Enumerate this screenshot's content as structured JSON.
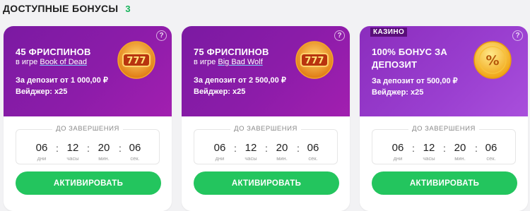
{
  "header": {
    "title": "ДОСТУПНЫЕ БОНУСЫ",
    "count": "3"
  },
  "colors": {
    "accent_green": "#23c55e",
    "card_purple": "#8c1ca9",
    "card_purple_light": "#9a3fd0",
    "count_green": "#17b45a"
  },
  "timer_units": {
    "days": "дни",
    "hours": "часы",
    "minutes": "мин.",
    "seconds": "сек."
  },
  "cards": [
    {
      "title": "45 ФРИСПИНОВ",
      "game_prefix": "в игре",
      "game": "Book of Dead",
      "deposit": "За депозит от 1 000,00 ₽",
      "wager": "Вейджер: x25",
      "help": "?",
      "badge_icon": "slot-777-icon",
      "timer_label": "ДО ЗАВЕРШЕНИЯ",
      "timer": {
        "days": "06",
        "hours": "12",
        "minutes": "20",
        "seconds": "06"
      },
      "button": "АКТИВИРОВАТЬ"
    },
    {
      "title": "75 ФРИСПИНОВ",
      "game_prefix": "в игре",
      "game": "Big Bad Wolf",
      "deposit": "За депозит от 2 500,00 ₽",
      "wager": "Вейджер: x25",
      "help": "?",
      "badge_icon": "slot-777-icon",
      "timer_label": "ДО ЗАВЕРШЕНИЯ",
      "timer": {
        "days": "06",
        "hours": "12",
        "minutes": "20",
        "seconds": "06"
      },
      "button": "АКТИВИРОВАТЬ"
    },
    {
      "tag": "КАЗИНО",
      "title": "100% БОНУС ЗА ДЕПОЗИТ",
      "deposit": "За депозит от 500,00 ₽",
      "wager": "Вейджер: x25",
      "help": "?",
      "badge_icon": "percent-coin-icon",
      "timer_label": "ДО ЗАВЕРШЕНИЯ",
      "timer": {
        "days": "06",
        "hours": "12",
        "minutes": "20",
        "seconds": "06"
      },
      "button": "АКТИВИРОВАТЬ"
    }
  ]
}
